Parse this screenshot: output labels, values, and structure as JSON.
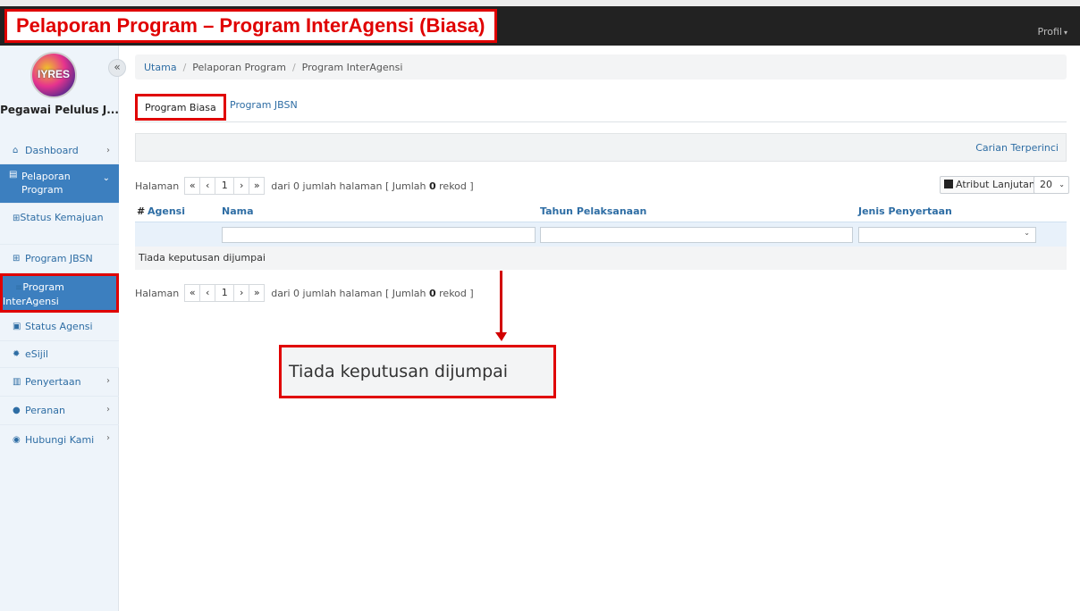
{
  "annotation": {
    "title": "Pelaporan Program – Program InterAgensi (Biasa)",
    "zoom_text": "Tiada keputusan dijumpai"
  },
  "topbar": {
    "profile_label": "Profil"
  },
  "sidebar": {
    "logo_text": "IYRES",
    "user_name": "Pegawai Pelulus J...",
    "items": [
      {
        "label": "Dashboard",
        "icon": "home-icon"
      },
      {
        "label": "Pelaporan Program",
        "icon": "report-icon"
      },
      {
        "label": "Status Kemajuan",
        "icon": "table-icon"
      },
      {
        "label": "Program JBSN",
        "icon": "table-icon"
      },
      {
        "label": "Program InterAgensi",
        "icon": "list-icon"
      },
      {
        "label": "Status Agensi",
        "icon": "id-card-icon"
      },
      {
        "label": "eSijil",
        "icon": "certificate-icon"
      },
      {
        "label": "Penyertaan",
        "icon": "clipboard-icon"
      },
      {
        "label": "Peranan",
        "icon": "user-icon"
      },
      {
        "label": "Hubungi Kami",
        "icon": "chat-icon"
      }
    ]
  },
  "breadcrumb": {
    "home": "Utama",
    "level1": "Pelaporan Program",
    "level2": "Program InterAgensi"
  },
  "tabs": {
    "active": "Program Biasa",
    "other": "Program JBSN"
  },
  "search": {
    "advanced_label": "Carian Terperinci"
  },
  "pager": {
    "prefix": "Halaman",
    "current_page": "1",
    "suffix_before": "dari 0 jumlah halaman [ Jumlah",
    "total": "0",
    "suffix_after": "rekod ]"
  },
  "toolbar": {
    "attr_label": "Atribut Lanjutan",
    "page_size": "20"
  },
  "table": {
    "columns": [
      "#",
      "Agensi",
      "Nama",
      "Tahun Pelaksanaan",
      "Jenis Penyertaan"
    ],
    "empty_message": "Tiada keputusan dijumpai"
  },
  "colors": {
    "annotation_red": "#e00000",
    "link_blue": "#2e6da4",
    "active_blue": "#3c7fbf",
    "topbar": "#222222"
  }
}
